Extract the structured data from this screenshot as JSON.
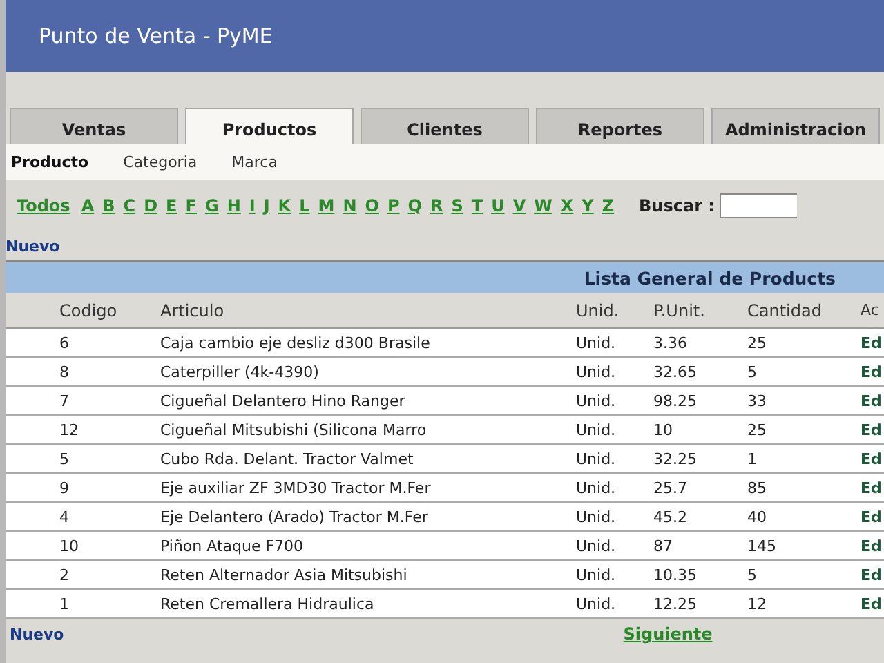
{
  "header": {
    "title": "Punto de Venta - PyME"
  },
  "tabs": [
    {
      "label": "Ventas",
      "selected": false
    },
    {
      "label": "Productos",
      "selected": true
    },
    {
      "label": "Clientes",
      "selected": false
    },
    {
      "label": "Reportes",
      "selected": false
    },
    {
      "label": "Administracion",
      "selected": false
    }
  ],
  "subnav": [
    {
      "label": "Producto",
      "selected": true
    },
    {
      "label": "Categoria",
      "selected": false
    },
    {
      "label": "Marca",
      "selected": false
    }
  ],
  "letters": [
    "Todos",
    "A",
    "B",
    "C",
    "D",
    "E",
    "F",
    "G",
    "H",
    "I",
    "J",
    "K",
    "L",
    "M",
    "N",
    "O",
    "P",
    "Q",
    "R",
    "S",
    "T",
    "U",
    "V",
    "W",
    "X",
    "Y",
    "Z"
  ],
  "search": {
    "label": "Buscar :"
  },
  "new_link_top": "Nuevo",
  "table": {
    "title": "Lista General de Products",
    "columns": [
      "Codigo",
      "Articulo",
      "Unid.",
      "P.Unit.",
      "Cantidad",
      "Ac"
    ],
    "rows": [
      [
        "6",
        "Caja cambio eje desliz d300 Brasile",
        "Unid.",
        "3.36",
        "25",
        "Ed"
      ],
      [
        "8",
        "Caterpiller (4k-4390)",
        "Unid.",
        "32.65",
        "5",
        "Ed"
      ],
      [
        "7",
        "Cigueñal Delantero Hino Ranger",
        "Unid.",
        "98.25",
        "33",
        "Ed"
      ],
      [
        "12",
        "Cigueñal Mitsubishi (Silicona Marro",
        "Unid.",
        "10",
        "25",
        "Ed"
      ],
      [
        "5",
        "Cubo Rda. Delant. Tractor Valmet",
        "Unid.",
        "32.25",
        "1",
        "Ed"
      ],
      [
        "9",
        "Eje auxiliar ZF 3MD30 Tractor M.Fer",
        "Unid.",
        "25.7",
        "85",
        "Ed"
      ],
      [
        "4",
        "Eje Delantero (Arado) Tractor M.Fer",
        "Unid.",
        "45.2",
        "40",
        "Ed"
      ],
      [
        "10",
        "Piñon Ataque F700",
        "Unid.",
        "87",
        "145",
        "Ed"
      ],
      [
        "2",
        "Reten Alternador Asia Mitsubishi",
        "Unid.",
        "10.35",
        "5",
        "Ed"
      ],
      [
        "1",
        "Reten Cremallera Hidraulica",
        "Unid.",
        "12.25",
        "12",
        "Ed"
      ]
    ]
  },
  "footer": {
    "new_link": "Nuevo",
    "next_link": "Siguiente"
  }
}
